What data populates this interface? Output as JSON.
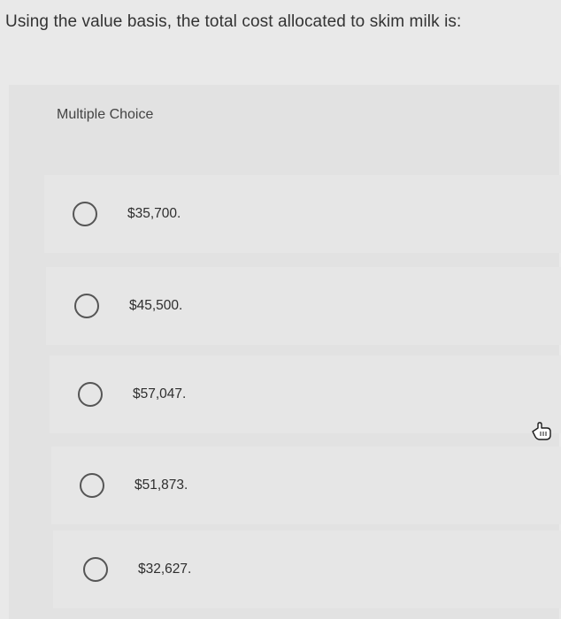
{
  "question": {
    "text": "Using the value basis, the total cost allocated to skim milk is:"
  },
  "card": {
    "label": "Multiple Choice"
  },
  "options": [
    {
      "label": "$35,700."
    },
    {
      "label": "$45,500."
    },
    {
      "label": "$57,047."
    },
    {
      "label": "$51,873."
    },
    {
      "label": "$32,627."
    }
  ],
  "cursor": {
    "icon": "hand-pointer-icon"
  }
}
